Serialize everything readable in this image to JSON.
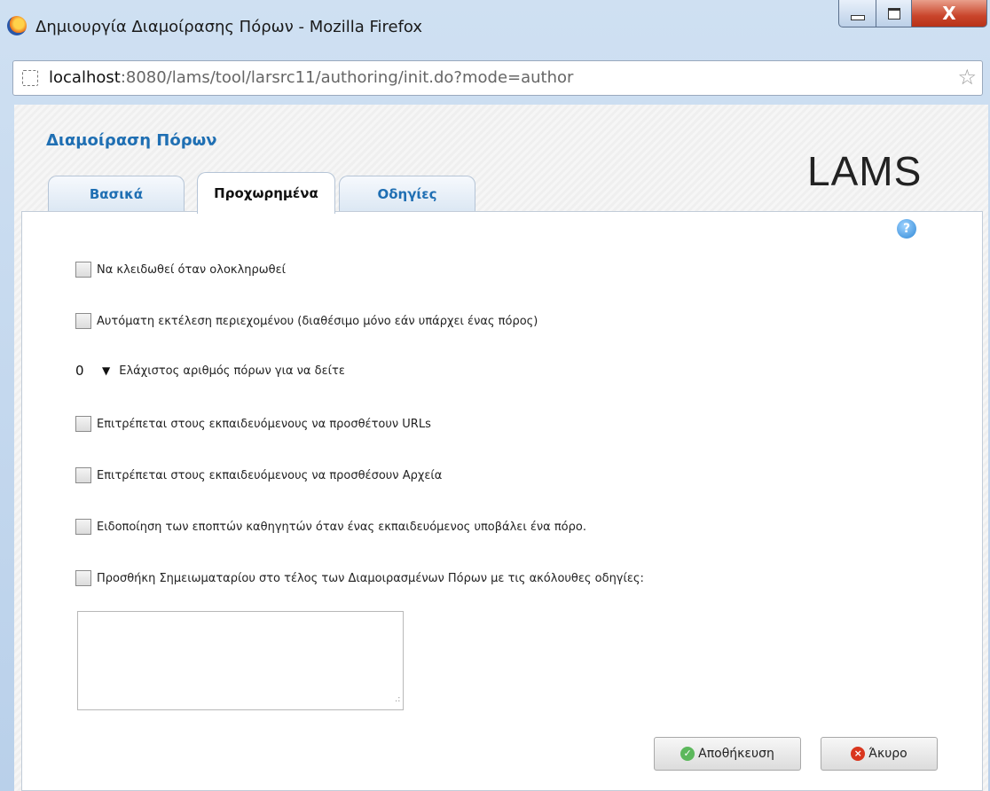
{
  "window": {
    "title": "Δημιουργία Διαμοίρασης Πόρων - Mozilla Firefox",
    "close_glyph": "X"
  },
  "urlbar": {
    "host": "localhost",
    "rest": ":8080/lams/tool/larsrc11/authoring/init.do?mode=author"
  },
  "page": {
    "heading": "Διαμοίραση Πόρων",
    "logo": "LAMS",
    "tabs": [
      {
        "label": "Βασικά",
        "active": false
      },
      {
        "label": "Προχωρημένα",
        "active": true
      },
      {
        "label": "Οδηγίες",
        "active": false
      }
    ],
    "help_glyph": "?",
    "options": [
      {
        "label": "Να κλειδωθεί όταν ολοκληρωθεί",
        "checked": false
      },
      {
        "label": "Αυτόματη εκτέλεση περιεχομένου (διαθέσιμο μόνο εάν υπάρχει ένας πόρος)",
        "checked": false
      },
      {
        "label": "Επιτρέπεται στους εκπαιδευόμενους να προσθέτουν URLs",
        "checked": false
      },
      {
        "label": "Επιτρέπεται στους εκπαιδευόμενους να προσθέσουν Αρχεία",
        "checked": false
      },
      {
        "label": "Ειδοποίηση των εποπτών καθηγητών όταν ένας εκπαιδευόμενος υποβάλει ένα πόρο.",
        "checked": false
      },
      {
        "label": "Προσθήκη Σημειωματαρίου στο τέλος των Διαμοιρασμένων Πόρων με τις ακόλουθες οδηγίες:",
        "checked": false
      }
    ],
    "min_resources": {
      "value": "0",
      "label": "Ελάχιστος αριθμός πόρων για να δείτε"
    },
    "notebook_text": "",
    "buttons": {
      "save": "Αποθήκευση",
      "cancel": "Άκυρο"
    }
  }
}
